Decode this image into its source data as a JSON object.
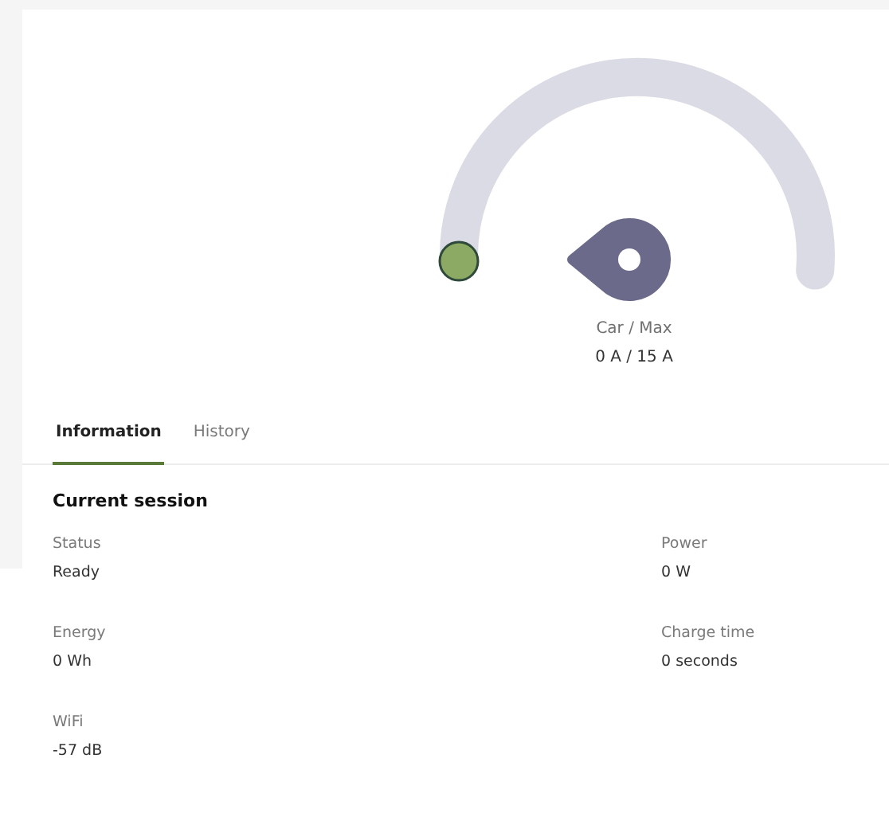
{
  "gauge": {
    "label": "Car / Max",
    "reading": "0 A / 15 A",
    "level": 0
  },
  "tabs": [
    {
      "label": "Information",
      "selected": true
    },
    {
      "label": "History",
      "selected": false
    }
  ],
  "session": {
    "title": "Current session",
    "fields": [
      {
        "label": "Status",
        "value": "Ready"
      },
      {
        "label": "Power",
        "value": "0 W"
      },
      {
        "label": "Energy",
        "value": "0 Wh"
      },
      {
        "label": "Charge time",
        "value": "0 seconds"
      },
      {
        "label": "WiFi",
        "value": "-57 dB"
      }
    ]
  }
}
